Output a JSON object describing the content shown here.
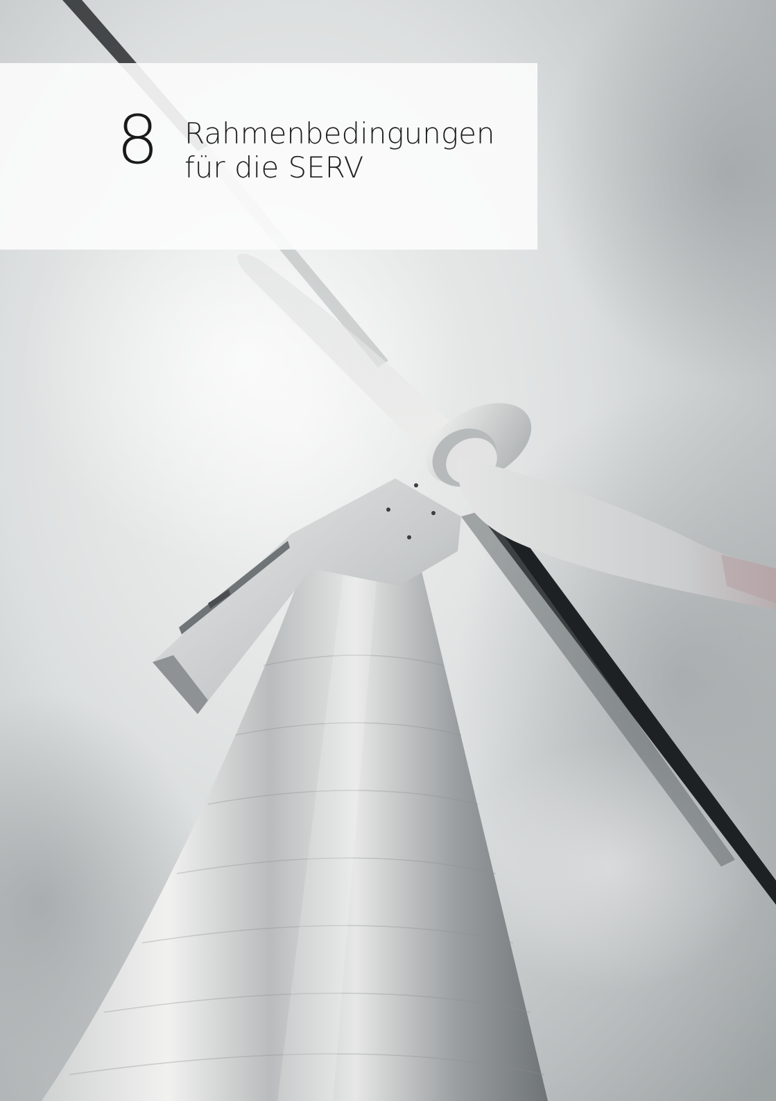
{
  "chapter": {
    "number": "8",
    "title_line1": "Rahmenbedingungen",
    "title_line2": "für die SERV"
  },
  "photo": {
    "subject": "wind-turbine-icon",
    "colors": {
      "sky_light": "#e4e6e5",
      "sky_dark": "#9ea3a4",
      "tower_light": "#e8e8e8",
      "tower_dark": "#7d8184",
      "panel": "#fcfcfc",
      "text": "#1a1a1a"
    }
  }
}
